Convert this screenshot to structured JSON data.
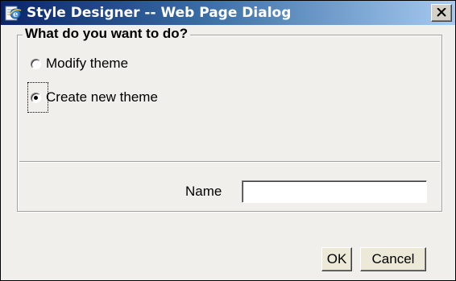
{
  "window": {
    "title": "Style Designer -- Web Page Dialog",
    "icon": "ie-page-icon",
    "close_icon": "close-icon"
  },
  "group": {
    "legend": "What do you want to do?",
    "options": [
      {
        "label": "Modify theme",
        "selected": false
      },
      {
        "label": "Create new theme",
        "selected": true
      }
    ]
  },
  "name_field": {
    "label": "Name",
    "value": "",
    "placeholder": ""
  },
  "buttons": {
    "ok_label": "OK",
    "cancel_label": "Cancel"
  },
  "colors": {
    "titlebar_start": "#0a246a",
    "titlebar_end": "#a6caf0",
    "dialog_background": "#f0efec"
  }
}
